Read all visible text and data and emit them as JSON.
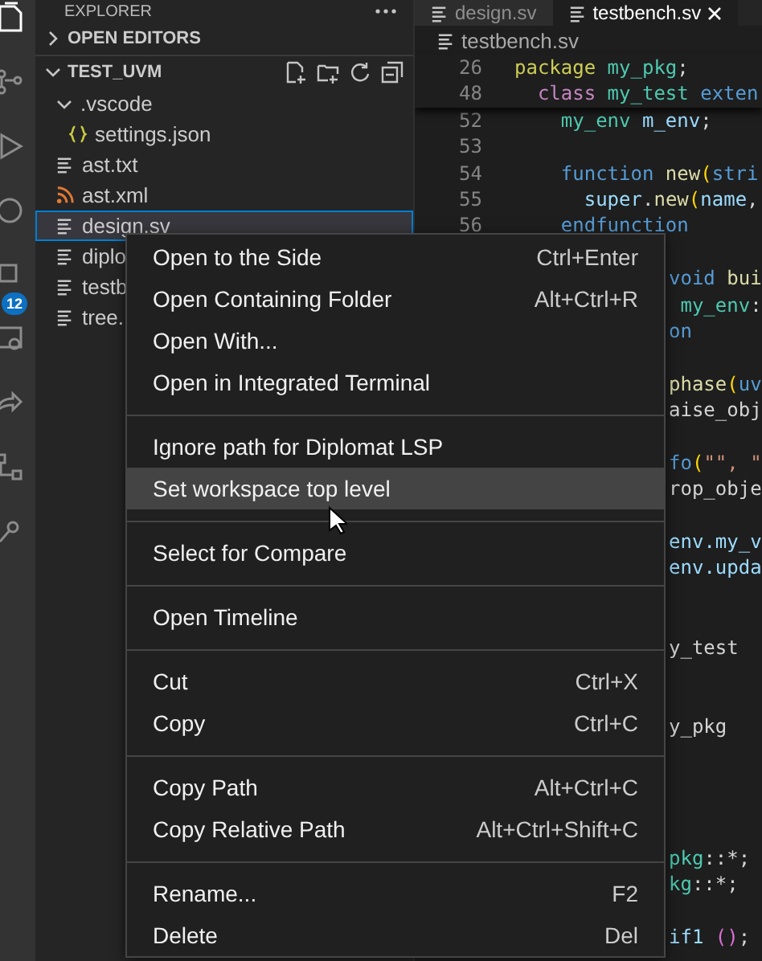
{
  "activity_bar": {
    "badge": "12"
  },
  "sidebar": {
    "title": "EXPLORER",
    "sections": [
      {
        "label": "OPEN EDITORS",
        "expanded": false
      },
      {
        "label": "TEST_UVM",
        "expanded": true
      }
    ],
    "tree": [
      {
        "label": ".vscode",
        "kind": "folder",
        "expanded": true,
        "selected": false,
        "children": [
          {
            "label": "settings.json",
            "kind": "json",
            "selected": false
          }
        ]
      },
      {
        "label": "ast.txt",
        "kind": "text",
        "selected": false
      },
      {
        "label": "ast.xml",
        "kind": "feed",
        "selected": false
      },
      {
        "label": "design.sv",
        "kind": "text",
        "selected": true
      },
      {
        "label": "diplo",
        "kind": "text",
        "selected": false
      },
      {
        "label": "testb",
        "kind": "text",
        "selected": false
      },
      {
        "label": "tree.",
        "kind": "text",
        "selected": false
      }
    ]
  },
  "editor": {
    "tabs": [
      {
        "label": "design.sv",
        "selected": false
      },
      {
        "label": "testbench.sv",
        "selected": true
      }
    ],
    "breadcrumb": "testbench.sv",
    "sticky_lines": [
      {
        "number": "26",
        "tokens": [
          {
            "text": "package ",
            "kind": "module"
          },
          {
            "text": "my_pkg",
            "kind": "type"
          },
          {
            "text": ";",
            "kind": "plain"
          }
        ]
      },
      {
        "number": "48",
        "tokens": [
          {
            "text": "  class ",
            "kind": "control"
          },
          {
            "text": "my_test ",
            "kind": "type"
          },
          {
            "text": "exten",
            "kind": "keyword"
          }
        ]
      }
    ],
    "code_lines": [
      {
        "kind": "numbered",
        "number": "52",
        "tokens": [
          {
            "text": "    my_env ",
            "kind": "type"
          },
          {
            "text": "m_env",
            "kind": "variable"
          },
          {
            "text": ";",
            "kind": "plain"
          }
        ]
      },
      {
        "kind": "numbered",
        "number": "53"
      },
      {
        "kind": "numbered",
        "number": "54",
        "tokens": [
          {
            "text": "    function ",
            "kind": "keyword"
          },
          {
            "text": "new",
            "kind": "function"
          },
          {
            "text": "(",
            "kind": "bracket"
          },
          {
            "text": "stri",
            "kind": "keyword"
          }
        ]
      },
      {
        "kind": "numbered",
        "number": "55",
        "tokens": [
          {
            "text": "      super",
            "kind": "variable"
          },
          {
            "text": ".",
            "kind": "plain"
          },
          {
            "text": "new",
            "kind": "function"
          },
          {
            "text": "(",
            "kind": "bracket"
          },
          {
            "text": "name",
            "kind": "variable"
          },
          {
            "text": ",",
            "kind": "plain"
          }
        ]
      },
      {
        "kind": "numbered",
        "number": "56",
        "tokens": [
          {
            "text": "    endfunction",
            "kind": "keyword"
          }
        ]
      },
      {
        "kind": "blank"
      },
      {
        "kind": "fragment",
        "tokens": [
          {
            "text": "void ",
            "kind": "keyword"
          },
          {
            "text": "bui",
            "kind": "function"
          }
        ]
      },
      {
        "kind": "fragment",
        "tokens": [
          {
            "text": " my_env",
            "kind": "type"
          },
          {
            "text": ":",
            "kind": "plain"
          }
        ]
      },
      {
        "kind": "fragment",
        "tokens": [
          {
            "text": "on",
            "kind": "keyword"
          }
        ]
      },
      {
        "kind": "blank"
      },
      {
        "kind": "fragment",
        "tokens": [
          {
            "text": "phase",
            "kind": "function"
          },
          {
            "text": "(",
            "kind": "bracket"
          },
          {
            "text": "uv",
            "kind": "keyword"
          }
        ]
      },
      {
        "kind": "fragment",
        "tokens": [
          {
            "text": "aise_obj",
            "kind": "plain"
          }
        ]
      },
      {
        "kind": "blank"
      },
      {
        "kind": "fragment",
        "tokens": [
          {
            "text": "fo",
            "kind": "keyword"
          },
          {
            "text": "(",
            "kind": "bracket"
          },
          {
            "text": "\"\", \"",
            "kind": "string"
          }
        ]
      },
      {
        "kind": "fragment",
        "tokens": [
          {
            "text": "rop_obje",
            "kind": "plain"
          }
        ]
      },
      {
        "kind": "blank"
      },
      {
        "kind": "fragment",
        "tokens": [
          {
            "text": "env",
            "kind": "variable"
          },
          {
            "text": ".my_v",
            "kind": "variable"
          }
        ]
      },
      {
        "kind": "fragment",
        "tokens": [
          {
            "text": "env",
            "kind": "variable"
          },
          {
            "text": ".upda",
            "kind": "variable"
          }
        ]
      },
      {
        "kind": "blank"
      },
      {
        "kind": "blank"
      },
      {
        "kind": "fragment",
        "tokens": [
          {
            "text": "y_test",
            "kind": "plain"
          }
        ]
      },
      {
        "kind": "blank"
      },
      {
        "kind": "blank"
      },
      {
        "kind": "fragment",
        "tokens": [
          {
            "text": "y_pkg",
            "kind": "plain"
          }
        ]
      },
      {
        "kind": "blank"
      },
      {
        "kind": "blank"
      },
      {
        "kind": "blank"
      },
      {
        "kind": "blank"
      },
      {
        "kind": "fragment",
        "tokens": [
          {
            "text": "pkg",
            "kind": "type"
          },
          {
            "text": "::*;",
            "kind": "plain"
          }
        ]
      },
      {
        "kind": "fragment",
        "tokens": [
          {
            "text": "kg",
            "kind": "type"
          },
          {
            "text": "::*;",
            "kind": "plain"
          }
        ]
      },
      {
        "kind": "blank"
      },
      {
        "kind": "fragment",
        "tokens": [
          {
            "text": "if1 ",
            "kind": "variable"
          },
          {
            "text": "()",
            "kind": "paren2"
          },
          {
            "text": ";",
            "kind": "plain"
          }
        ]
      }
    ]
  },
  "context_menu": {
    "groups": [
      [
        {
          "label": "Open to the Side",
          "shortcut": "Ctrl+Enter",
          "hovered": false
        },
        {
          "label": "Open Containing Folder",
          "shortcut": "Alt+Ctrl+R",
          "hovered": false
        },
        {
          "label": "Open With...",
          "hovered": false
        },
        {
          "label": "Open in Integrated Terminal",
          "hovered": false
        }
      ],
      [
        {
          "label": "Ignore path for Diplomat LSP",
          "hovered": false
        },
        {
          "label": "Set workspace top level",
          "hovered": true
        }
      ],
      [
        {
          "label": "Select for Compare",
          "hovered": false
        }
      ],
      [
        {
          "label": "Open Timeline",
          "hovered": false
        }
      ],
      [
        {
          "label": "Cut",
          "shortcut": "Ctrl+X",
          "hovered": false
        },
        {
          "label": "Copy",
          "shortcut": "Ctrl+C",
          "hovered": false
        }
      ],
      [
        {
          "label": "Copy Path",
          "shortcut": "Alt+Ctrl+C",
          "hovered": false
        },
        {
          "label": "Copy Relative Path",
          "shortcut": "Alt+Ctrl+Shift+C",
          "hovered": false
        }
      ],
      [
        {
          "label": "Rename...",
          "shortcut": "F2",
          "hovered": false
        },
        {
          "label": "Delete",
          "shortcut": "Del",
          "hovered": false
        }
      ]
    ]
  }
}
